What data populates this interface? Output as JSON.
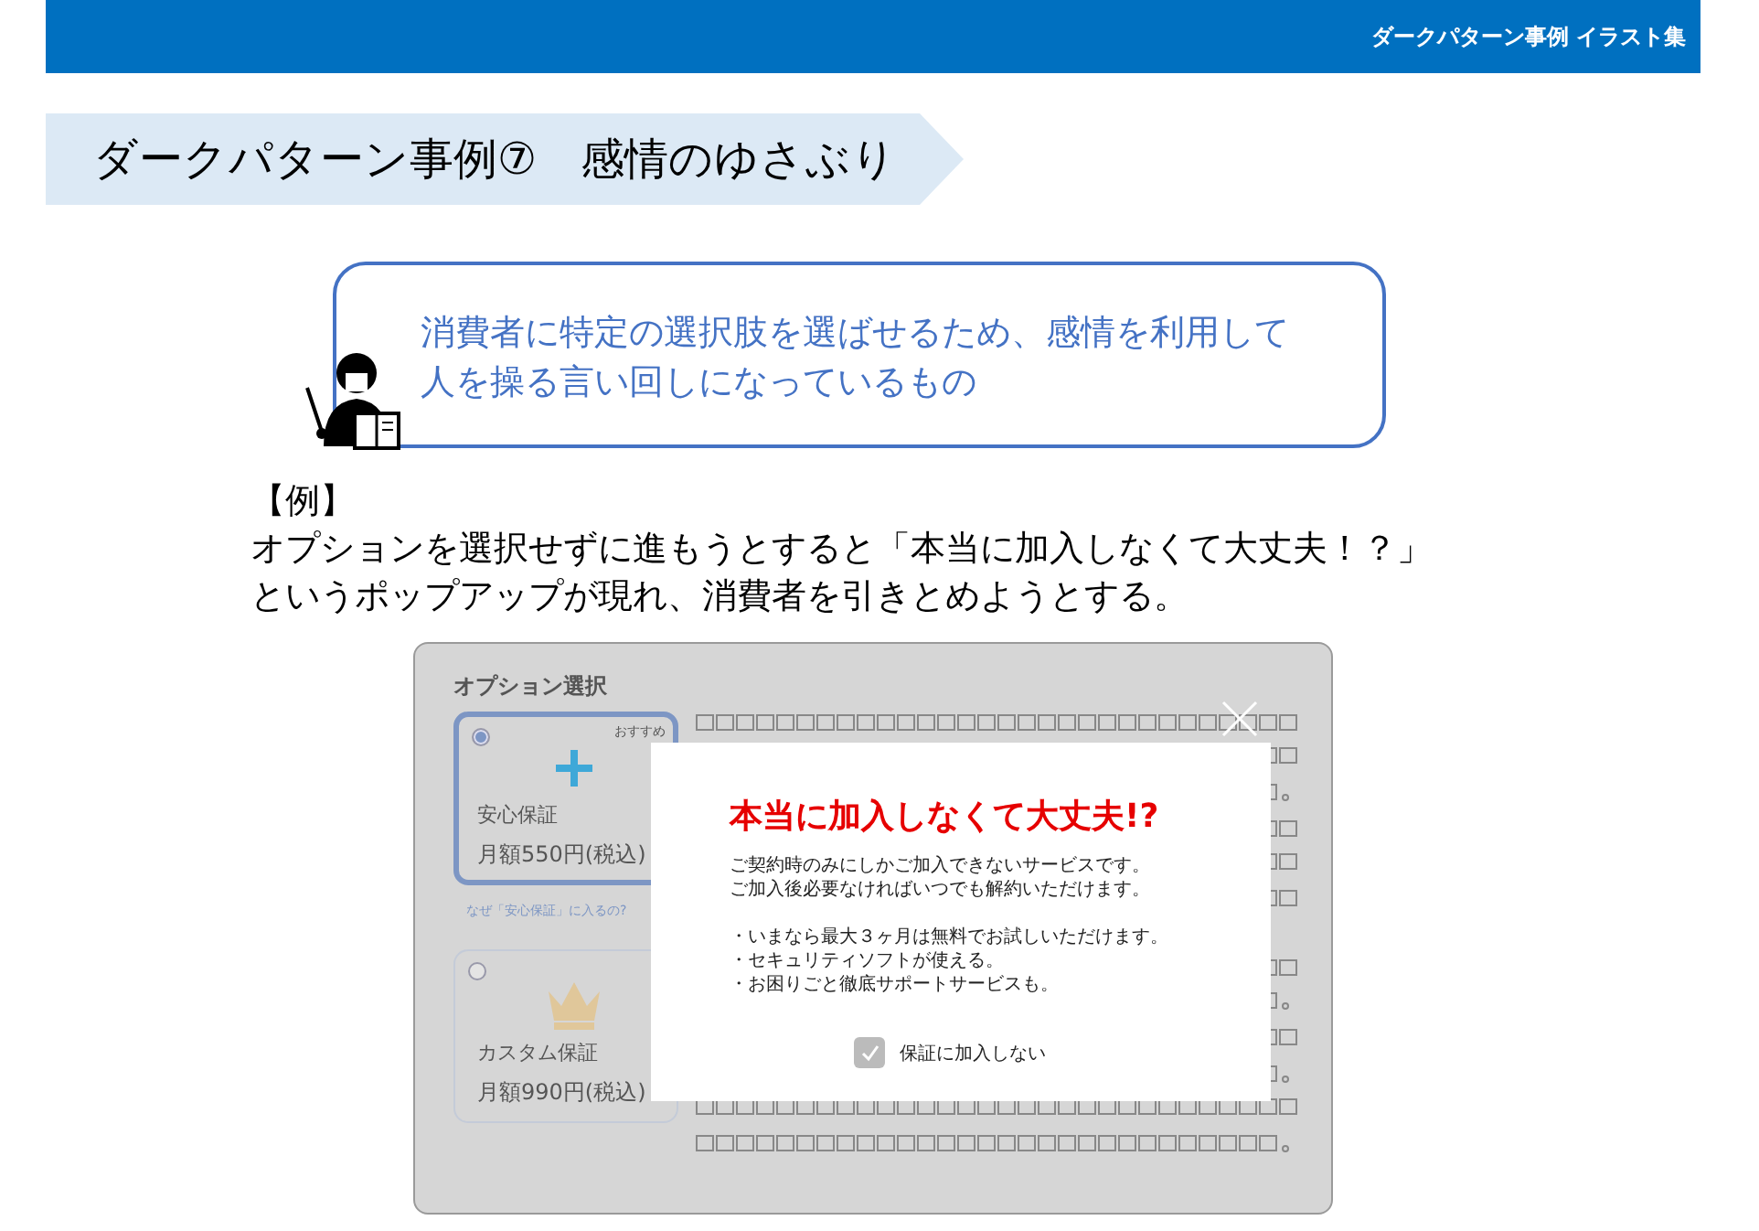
{
  "header": {
    "title": "ダークパターン事例 イラスト集"
  },
  "heading": {
    "title": "ダークパターン事例⑦　感情のゆさぶり"
  },
  "definition": {
    "lines": [
      "消費者に特定の選択肢を選ばせるため、感情を利用して",
      "人を操る言い回しになっているもの"
    ]
  },
  "example": {
    "label": "【例】",
    "lines": [
      "オプションを選択せずに進もうとすると「本当に加入しなくて大丈夫！？」",
      "というポップアップが現れ、消費者を引きとめようとする。"
    ]
  },
  "mock": {
    "title": "オプション選択",
    "options": [
      {
        "kind": "plus",
        "badge": "おすすめ",
        "name": "安心保証",
        "price": "月額550円(税込)",
        "selected": true
      },
      {
        "kind": "crown",
        "name": "カスタム保証",
        "price": "月額990円(税込)",
        "selected": false
      }
    ],
    "link": "なぜ「安心保証」に入るの?",
    "popup": {
      "title": "本当に加入しなくて大丈夫!?",
      "lines": [
        "ご契約時のみにしかご加入できないサービスです。",
        "ご加入後必要なければいつでも解約いただけます。"
      ],
      "bullets": [
        "・いまなら最大３ヶ月は無料でお試しいただけます。",
        "・セキュリティソフトが使える。",
        "・お困りごと徹底サポートサービスも。"
      ],
      "checkbox": {
        "label": "保証に加入しない",
        "checked": true
      }
    }
  }
}
